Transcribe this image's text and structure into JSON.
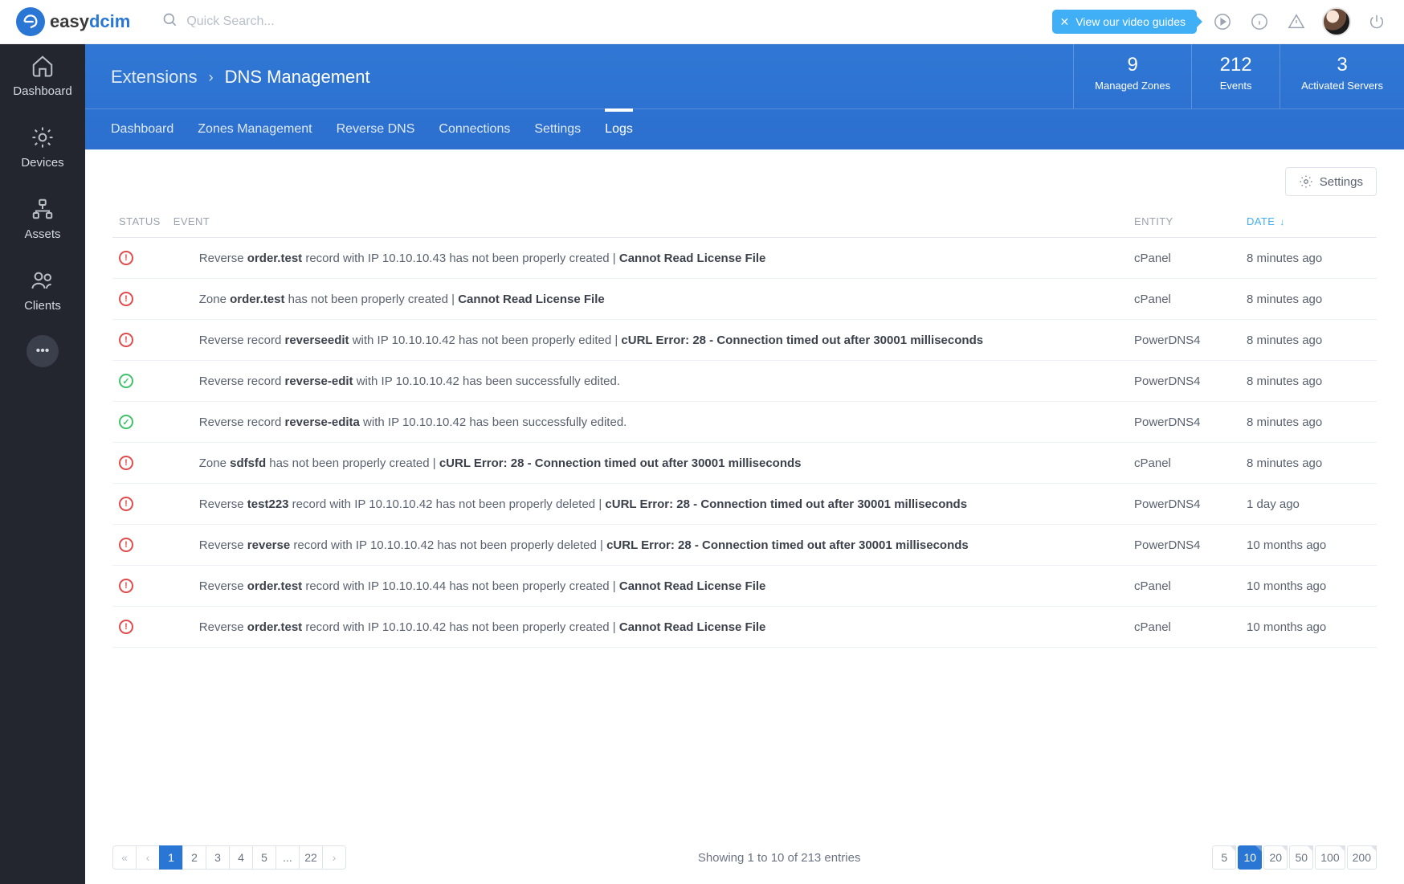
{
  "brand": {
    "name_main": "easy",
    "name_accent": "dcim"
  },
  "search": {
    "placeholder": "Quick Search..."
  },
  "guides": {
    "label": "View our video guides"
  },
  "sidebar": {
    "items": [
      {
        "label": "Dashboard",
        "icon": "home"
      },
      {
        "label": "Devices",
        "icon": "gear"
      },
      {
        "label": "Assets",
        "icon": "hierarchy"
      },
      {
        "label": "Clients",
        "icon": "users"
      }
    ]
  },
  "breadcrumb": {
    "parent": "Extensions",
    "current": "DNS Management"
  },
  "stats": [
    {
      "value": "9",
      "label": "Managed Zones"
    },
    {
      "value": "212",
      "label": "Events"
    },
    {
      "value": "3",
      "label": "Activated Servers"
    }
  ],
  "tabs": [
    "Dashboard",
    "Zones Management",
    "Reverse DNS",
    "Connections",
    "Settings",
    "Logs"
  ],
  "active_tab": "Logs",
  "settings_btn": "Settings",
  "table": {
    "cols": {
      "status": "STATUS",
      "event": "EVENT",
      "entity": "ENTITY",
      "date": "DATE"
    },
    "rows": [
      {
        "status": "error",
        "event": [
          {
            "t": "Reverse "
          },
          {
            "b": "order.test"
          },
          {
            "t": " record with IP 10.10.10.43 has not been properly created | "
          },
          {
            "b": "Cannot Read License File"
          }
        ],
        "entity": "cPanel",
        "date": "8 minutes ago"
      },
      {
        "status": "error",
        "event": [
          {
            "t": "Zone "
          },
          {
            "b": "order.test"
          },
          {
            "t": " has not been properly created | "
          },
          {
            "b": "Cannot Read License File"
          }
        ],
        "entity": "cPanel",
        "date": "8 minutes ago"
      },
      {
        "status": "error",
        "event": [
          {
            "t": "Reverse record "
          },
          {
            "b": "reverseedit"
          },
          {
            "t": " with IP 10.10.10.42 has not been properly edited | "
          },
          {
            "b": "cURL Error: 28 - Connection timed out after 30001 milliseconds"
          }
        ],
        "entity": "PowerDNS4",
        "date": "8 minutes ago"
      },
      {
        "status": "success",
        "event": [
          {
            "t": "Reverse record "
          },
          {
            "b": "reverse-edit"
          },
          {
            "t": " with IP 10.10.10.42 has been successfully edited."
          }
        ],
        "entity": "PowerDNS4",
        "date": "8 minutes ago"
      },
      {
        "status": "success",
        "event": [
          {
            "t": "Reverse record "
          },
          {
            "b": "reverse-edita"
          },
          {
            "t": " with IP 10.10.10.42 has been successfully edited."
          }
        ],
        "entity": "PowerDNS4",
        "date": "8 minutes ago"
      },
      {
        "status": "error",
        "event": [
          {
            "t": "Zone "
          },
          {
            "b": "sdfsfd"
          },
          {
            "t": " has not been properly created | "
          },
          {
            "b": "cURL Error: 28 - Connection timed out after 30001 milliseconds"
          }
        ],
        "entity": "cPanel",
        "date": "8 minutes ago"
      },
      {
        "status": "error",
        "event": [
          {
            "t": "Reverse "
          },
          {
            "b": "test223"
          },
          {
            "t": " record with IP 10.10.10.42 has not been properly deleted | "
          },
          {
            "b": "cURL Error: 28 - Connection timed out after 30001 milliseconds"
          }
        ],
        "entity": "PowerDNS4",
        "date": "1 day ago"
      },
      {
        "status": "error",
        "event": [
          {
            "t": "Reverse "
          },
          {
            "b": "reverse"
          },
          {
            "t": " record with IP 10.10.10.42 has not been properly deleted | "
          },
          {
            "b": "cURL Error: 28 - Connection timed out after 30001 milliseconds"
          }
        ],
        "entity": "PowerDNS4",
        "date": "10 months ago"
      },
      {
        "status": "error",
        "event": [
          {
            "t": "Reverse "
          },
          {
            "b": "order.test"
          },
          {
            "t": " record with IP 10.10.10.44 has not been properly created | "
          },
          {
            "b": "Cannot Read License File"
          }
        ],
        "entity": "cPanel",
        "date": "10 months ago"
      },
      {
        "status": "error",
        "event": [
          {
            "t": "Reverse "
          },
          {
            "b": "order.test"
          },
          {
            "t": " record with IP 10.10.10.42 has not been properly created | "
          },
          {
            "b": "Cannot Read License File"
          }
        ],
        "entity": "cPanel",
        "date": "10 months ago"
      }
    ]
  },
  "pagination": {
    "pages": [
      "1",
      "2",
      "3",
      "4",
      "5",
      "...",
      "22"
    ],
    "active_page": "1",
    "summary": "Showing 1 to 10 of 213 entries",
    "sizes": [
      "5",
      "10",
      "20",
      "50",
      "100",
      "200"
    ],
    "active_size": "10"
  }
}
